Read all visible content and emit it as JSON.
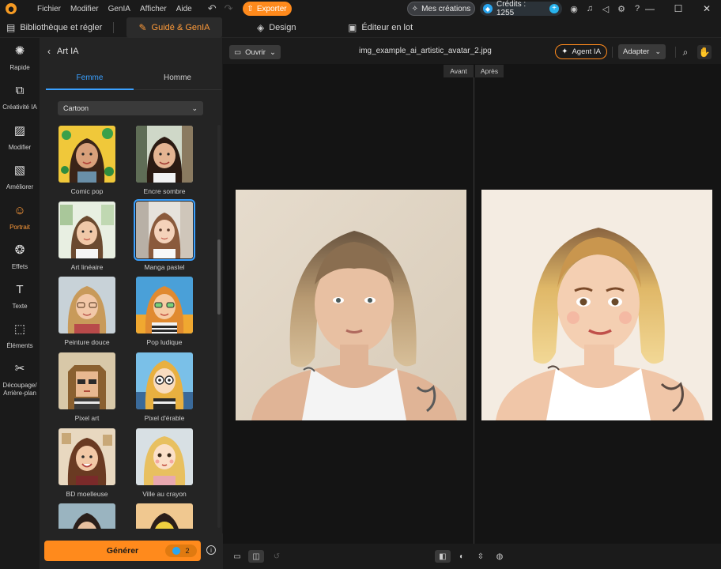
{
  "menu": [
    "Fichier",
    "Modifier",
    "GenIA",
    "Afficher",
    "Aide"
  ],
  "titlebar": {
    "export_label": "Exporter",
    "mes_creations_label": "Mes créations",
    "credits_label": "Crédits : 1255"
  },
  "modules": {
    "library_label": "Bibliothèque et régler",
    "guide_label": "Guidé & GenIA",
    "design_label": "Design",
    "batch_label": "Éditeur en lot"
  },
  "rail": {
    "rapide": "Rapide",
    "creativite": "Créativité IA",
    "modifier": "Modifier",
    "ameliorer": "Améliorer",
    "portrait": "Portrait",
    "effets": "Effets",
    "texte": "Texte",
    "elements": "Éléments",
    "decoupage_1": "Découpage/",
    "decoupage_2": "Arrière-plan"
  },
  "panel": {
    "title": "Art IA",
    "tabs": [
      "Femme",
      "Homme"
    ],
    "active_tab": "Femme",
    "style_value": "Cartoon",
    "styles": [
      {
        "label": "Comic pop"
      },
      {
        "label": "Encre sombre"
      },
      {
        "label": "Art linéaire"
      },
      {
        "label": "Manga pastel",
        "selected": true
      },
      {
        "label": "Peinture douce"
      },
      {
        "label": "Pop ludique"
      },
      {
        "label": "Pixel art"
      },
      {
        "label": "Pixel d'érable"
      },
      {
        "label": "BD moelleuse"
      },
      {
        "label": "Ville au crayon"
      },
      {
        "label": ""
      },
      {
        "label": ""
      }
    ],
    "generate_label": "Générer",
    "generate_cost": "2"
  },
  "work": {
    "open_label": "Ouvrir",
    "file_name": "img_example_ai_artistic_avatar_2.jpg",
    "agent_label": "Agent IA",
    "fit_label": "Adapter",
    "before_label": "Avant",
    "after_label": "Après"
  },
  "colors": {
    "accent": "#ff8a1c",
    "tab_active": "#3aa0ff",
    "credit_icon": "#2aa6f0"
  }
}
